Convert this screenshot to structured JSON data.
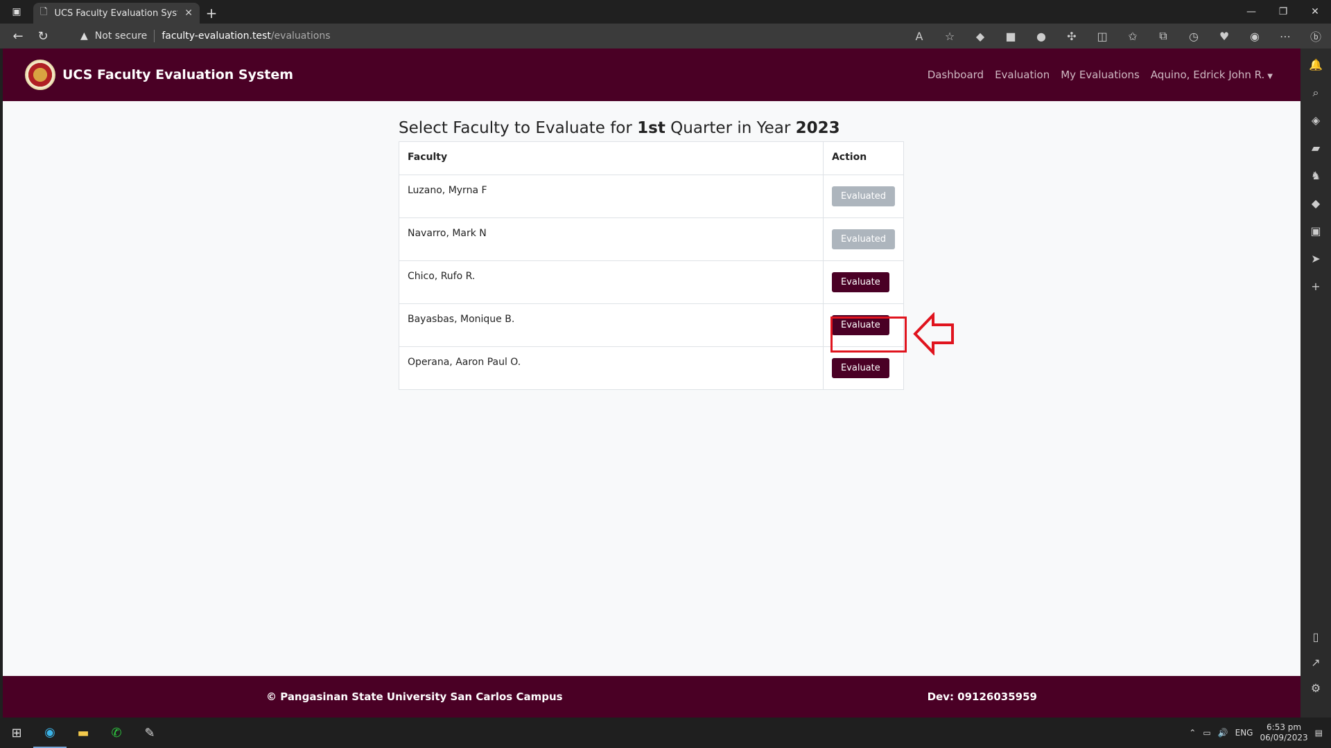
{
  "browser": {
    "tab_title": "UCS Faculty Evaluation System",
    "security_label": "Not secure",
    "url_host": "faculty-evaluation.test",
    "url_path": "/evaluations"
  },
  "app": {
    "brand": "UCS Faculty Evaluation System",
    "nav": {
      "dashboard": "Dashboard",
      "evaluation": "Evaluation",
      "my_evaluations": "My Evaluations",
      "user": "Aquino, Edrick John R."
    }
  },
  "page": {
    "title_prefix": "Select Faculty to Evaluate for ",
    "quarter": "1st",
    "title_mid": " Quarter in Year ",
    "year": "2023",
    "table": {
      "headers": [
        "Faculty",
        "Action"
      ],
      "rows": [
        {
          "faculty": "Luzano, Myrna F",
          "action": "Evaluated"
        },
        {
          "faculty": "Navarro, Mark N",
          "action": "Evaluated"
        },
        {
          "faculty": "Chico, Rufo R.",
          "action": "Evaluate"
        },
        {
          "faculty": "Bayasbas, Monique B.",
          "action": "Evaluate"
        },
        {
          "faculty": "Operana, Aaron Paul O.",
          "action": "Evaluate"
        }
      ]
    }
  },
  "footer": {
    "copyright": "© Pangasinan State University San Carlos Campus",
    "dev": "Dev: 09126035959"
  },
  "taskbar": {
    "lang": "ENG",
    "time": "6:53 pm",
    "date": "06/09/2023"
  },
  "colors": {
    "brand": "#4a0025",
    "evaluated_button": "#adb5bd",
    "highlight": "#e0141e"
  }
}
